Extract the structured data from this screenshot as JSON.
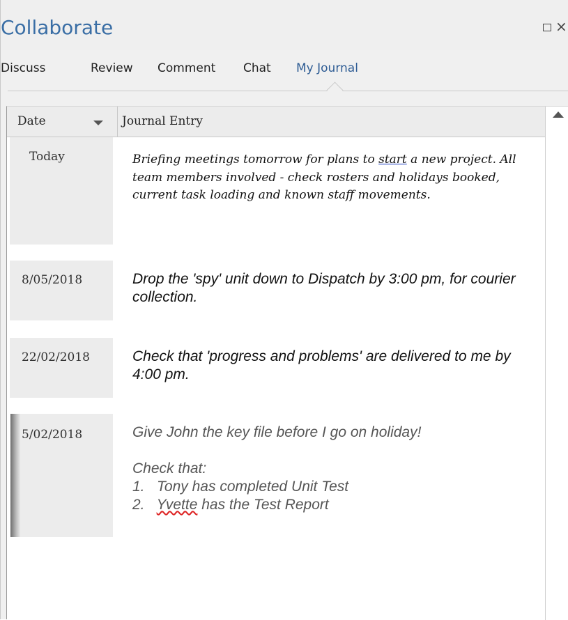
{
  "window": {
    "title": "Collaborate",
    "maximize_icon": "square-icon",
    "close_label": "×"
  },
  "tabs": [
    {
      "label": "Discuss"
    },
    {
      "label": "Review"
    },
    {
      "label": "Comment"
    },
    {
      "label": "Chat"
    },
    {
      "label": "My Journal",
      "active": true
    }
  ],
  "grid": {
    "columns": [
      "Date",
      "Journal Entry"
    ],
    "sort_icon": "triangle-down-icon",
    "rows": [
      {
        "date": "Today",
        "entry_pre": "Briefing meetings tomorrow for plans to ",
        "entry_underlined": "start",
        "entry_post": " a new project. All team members involved - check rosters and holidays booked, current task loading and known staff movements."
      },
      {
        "date": "8/05/2018",
        "entry": "Drop the 'spy' unit down to Dispatch by 3:00 pm, for courier collection."
      },
      {
        "date": "22/02/2018",
        "entry": "Check that 'progress and problems' are delivered to me by 4:00 pm."
      },
      {
        "date": "5/02/2018",
        "entry_line1": "Give John the key file before I go on holiday!",
        "entry_line2": "Check that:",
        "list": [
          {
            "num": "1.",
            "text": "Tony has completed Unit Test"
          },
          {
            "num": "2.",
            "name": "Yvette",
            "text": " has the Test Report"
          }
        ],
        "selected": true
      }
    ]
  },
  "colors": {
    "title": "#3a6ea5",
    "active_tab": "#2e5c94",
    "header_bg": "#ececec"
  }
}
